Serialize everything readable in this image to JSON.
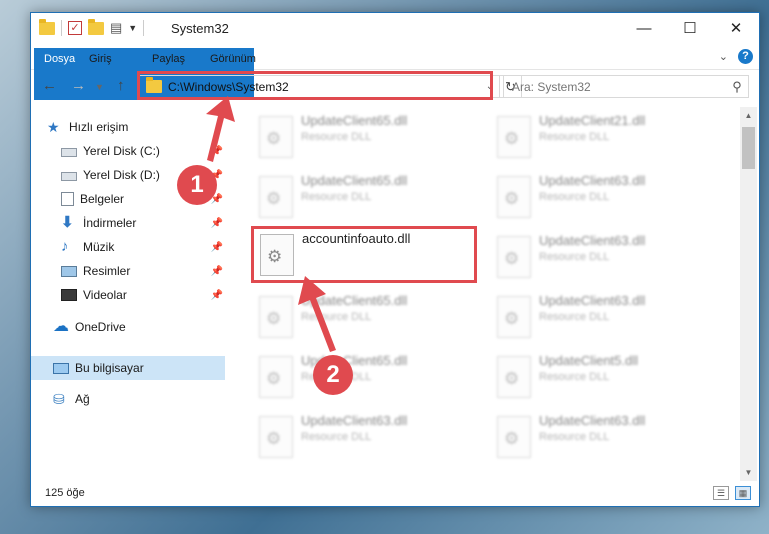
{
  "window": {
    "title": "System32",
    "controls": {
      "minimize": "—",
      "maximize": "☐",
      "close": "✕"
    }
  },
  "ribbon": {
    "tabs": [
      {
        "label": "Dosya"
      },
      {
        "label": "Giriş"
      },
      {
        "label": "Paylaş"
      },
      {
        "label": "Görünüm"
      }
    ],
    "help": "?"
  },
  "navigation": {
    "address": "C:\\Windows\\System32",
    "search_placeholder": "Ara: System32"
  },
  "sidebar": {
    "items": [
      {
        "label": "Hızlı erişim",
        "icon": "star-icon"
      },
      {
        "label": "Yerel Disk (C:)",
        "icon": "disk-icon",
        "pinned": true
      },
      {
        "label": "Yerel Disk (D:)",
        "icon": "disk-icon",
        "pinned": true
      },
      {
        "label": "Belgeler",
        "icon": "documents-icon",
        "pinned": true
      },
      {
        "label": "İndirmeler",
        "icon": "download-icon",
        "pinned": true
      },
      {
        "label": "Müzik",
        "icon": "music-icon",
        "pinned": true
      },
      {
        "label": "Resimler",
        "icon": "pictures-icon",
        "pinned": true
      },
      {
        "label": "Videolar",
        "icon": "videos-icon",
        "pinned": true
      },
      {
        "label": "OneDrive",
        "icon": "cloud-icon"
      },
      {
        "label": "Bu bilgisayar",
        "icon": "computer-icon",
        "selected": true
      },
      {
        "label": "Ağ",
        "icon": "network-icon"
      }
    ]
  },
  "files": {
    "highlighted": {
      "name": "accountinfoauto.dll"
    },
    "blurred": [
      {
        "name": "UpdateClient65.dll",
        "type": "Resource DLL"
      },
      {
        "name": "UpdateClient21.dll",
        "type": "Resource DLL"
      },
      {
        "name": "UpdateClient65.dll",
        "type": "Resource DLL"
      },
      {
        "name": "UpdateClient63.dll",
        "type": "Resource DLL"
      },
      {
        "name": "UpdateClient63.dll",
        "type": "Resource DLL"
      },
      {
        "name": "UpdateClient65.dll",
        "type": "Resource DLL"
      },
      {
        "name": "UpdateClient63.dll",
        "type": "Resource DLL"
      },
      {
        "name": "UpdateClient65.dll",
        "type": "Resource DLL"
      },
      {
        "name": "UpdateClient5.dll",
        "type": "Resource DLL"
      },
      {
        "name": "UpdateClient63.dll",
        "type": "Resource DLL"
      },
      {
        "name": "UpdateClient63.dll",
        "type": "Resource DLL"
      }
    ]
  },
  "status": {
    "item_count": "125 öğe"
  },
  "annotations": {
    "step1": "1",
    "step2": "2",
    "color": "#e04a4f"
  }
}
